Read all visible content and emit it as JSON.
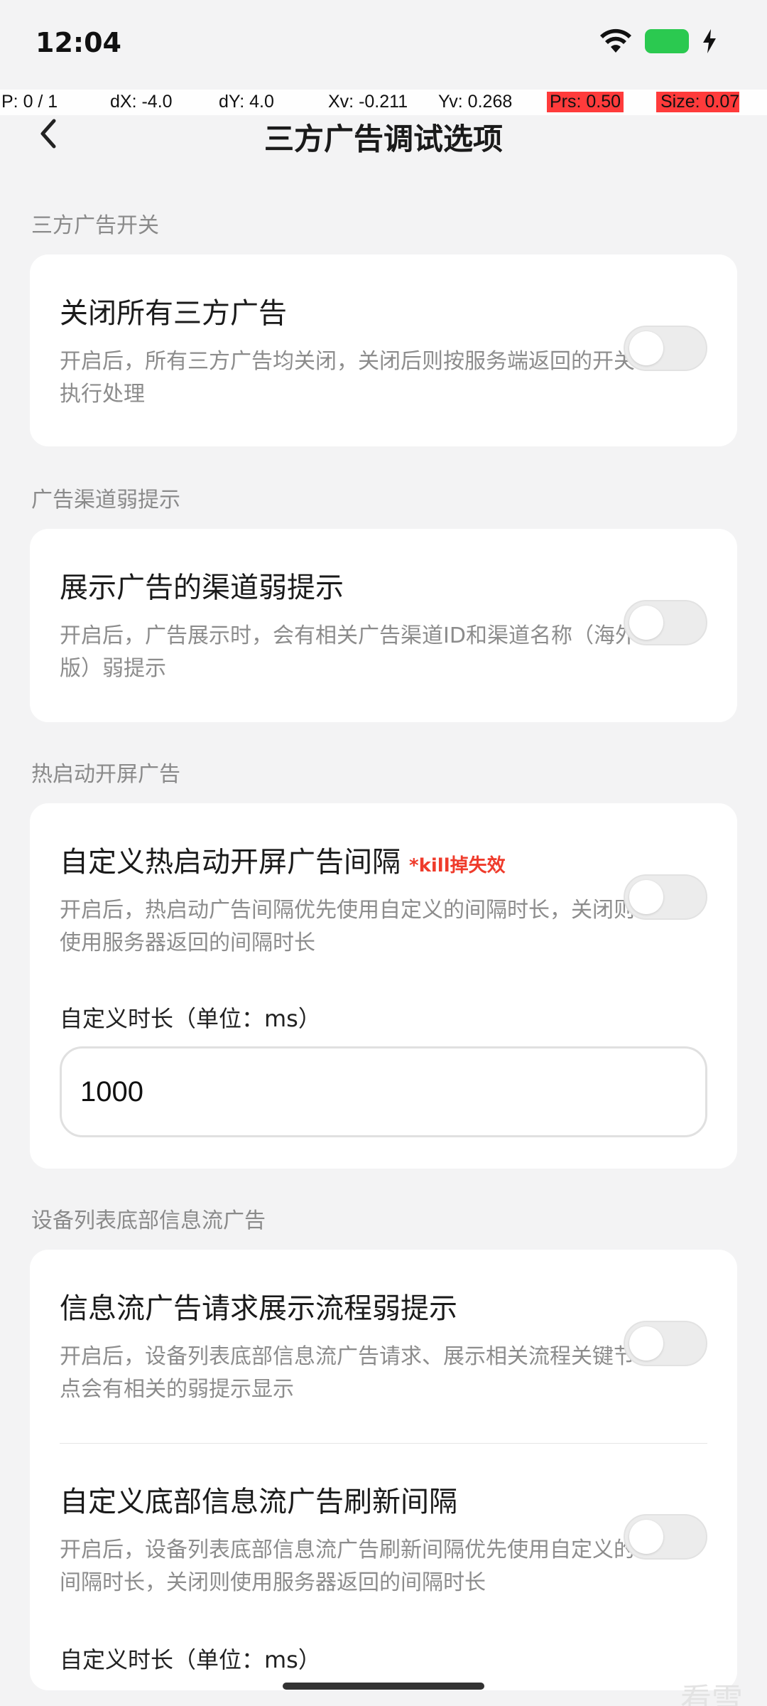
{
  "status_bar": {
    "time": "12:04",
    "battery_color": "#2bc950",
    "icons": [
      "wifi-icon",
      "battery-icon",
      "charging-bolt-icon"
    ]
  },
  "debug": {
    "p": "P: 0 / 1",
    "dx": "dX: -4.0",
    "dy": "dY: 4.0",
    "xv": "Xv: -0.211",
    "yv": "Yv: 0.268",
    "prs": "Prs: 0.50",
    "size": "Size: 0.07"
  },
  "header": {
    "title": "三方广告调试选项",
    "back_icon": "chevron-left-icon"
  },
  "sections": [
    {
      "title": "三方广告开关",
      "rows": [
        {
          "title": "关闭所有三方广告",
          "desc": "开启后，所有三方广告均关闭，关闭后则按服务端返回的开关执行处理",
          "on": false
        }
      ]
    },
    {
      "title": "广告渠道弱提示",
      "rows": [
        {
          "title": "展示广告的渠道弱提示",
          "desc": "开启后，广告展示时，会有相关广告渠道ID和渠道名称（海外版）弱提示",
          "on": false
        }
      ]
    },
    {
      "title": "热启动开屏广告",
      "rows": [
        {
          "title": "自定义热启动开屏广告间隔",
          "badge": "*kill掉失效",
          "desc": "开启后，热启动广告间隔优先使用自定义的间隔时长，关闭则使用服务器返回的间隔时长",
          "on": false
        }
      ],
      "field_label": "自定义时长（单位：ms）",
      "field_value": "1000"
    },
    {
      "title": "设备列表底部信息流广告",
      "rows": [
        {
          "title": "信息流广告请求展示流程弱提示",
          "desc": "开启后，设备列表底部信息流广告请求、展示相关流程关键节点会有相关的弱提示显示",
          "on": false
        },
        {
          "title": "自定义底部信息流广告刷新间隔",
          "desc": "开启后，设备列表底部信息流广告刷新间隔优先使用自定义的间隔时长，关闭则使用服务器返回的间隔时长",
          "on": false
        }
      ],
      "field_label": "自定义时长（单位：ms）"
    }
  ],
  "watermark": "看雪"
}
